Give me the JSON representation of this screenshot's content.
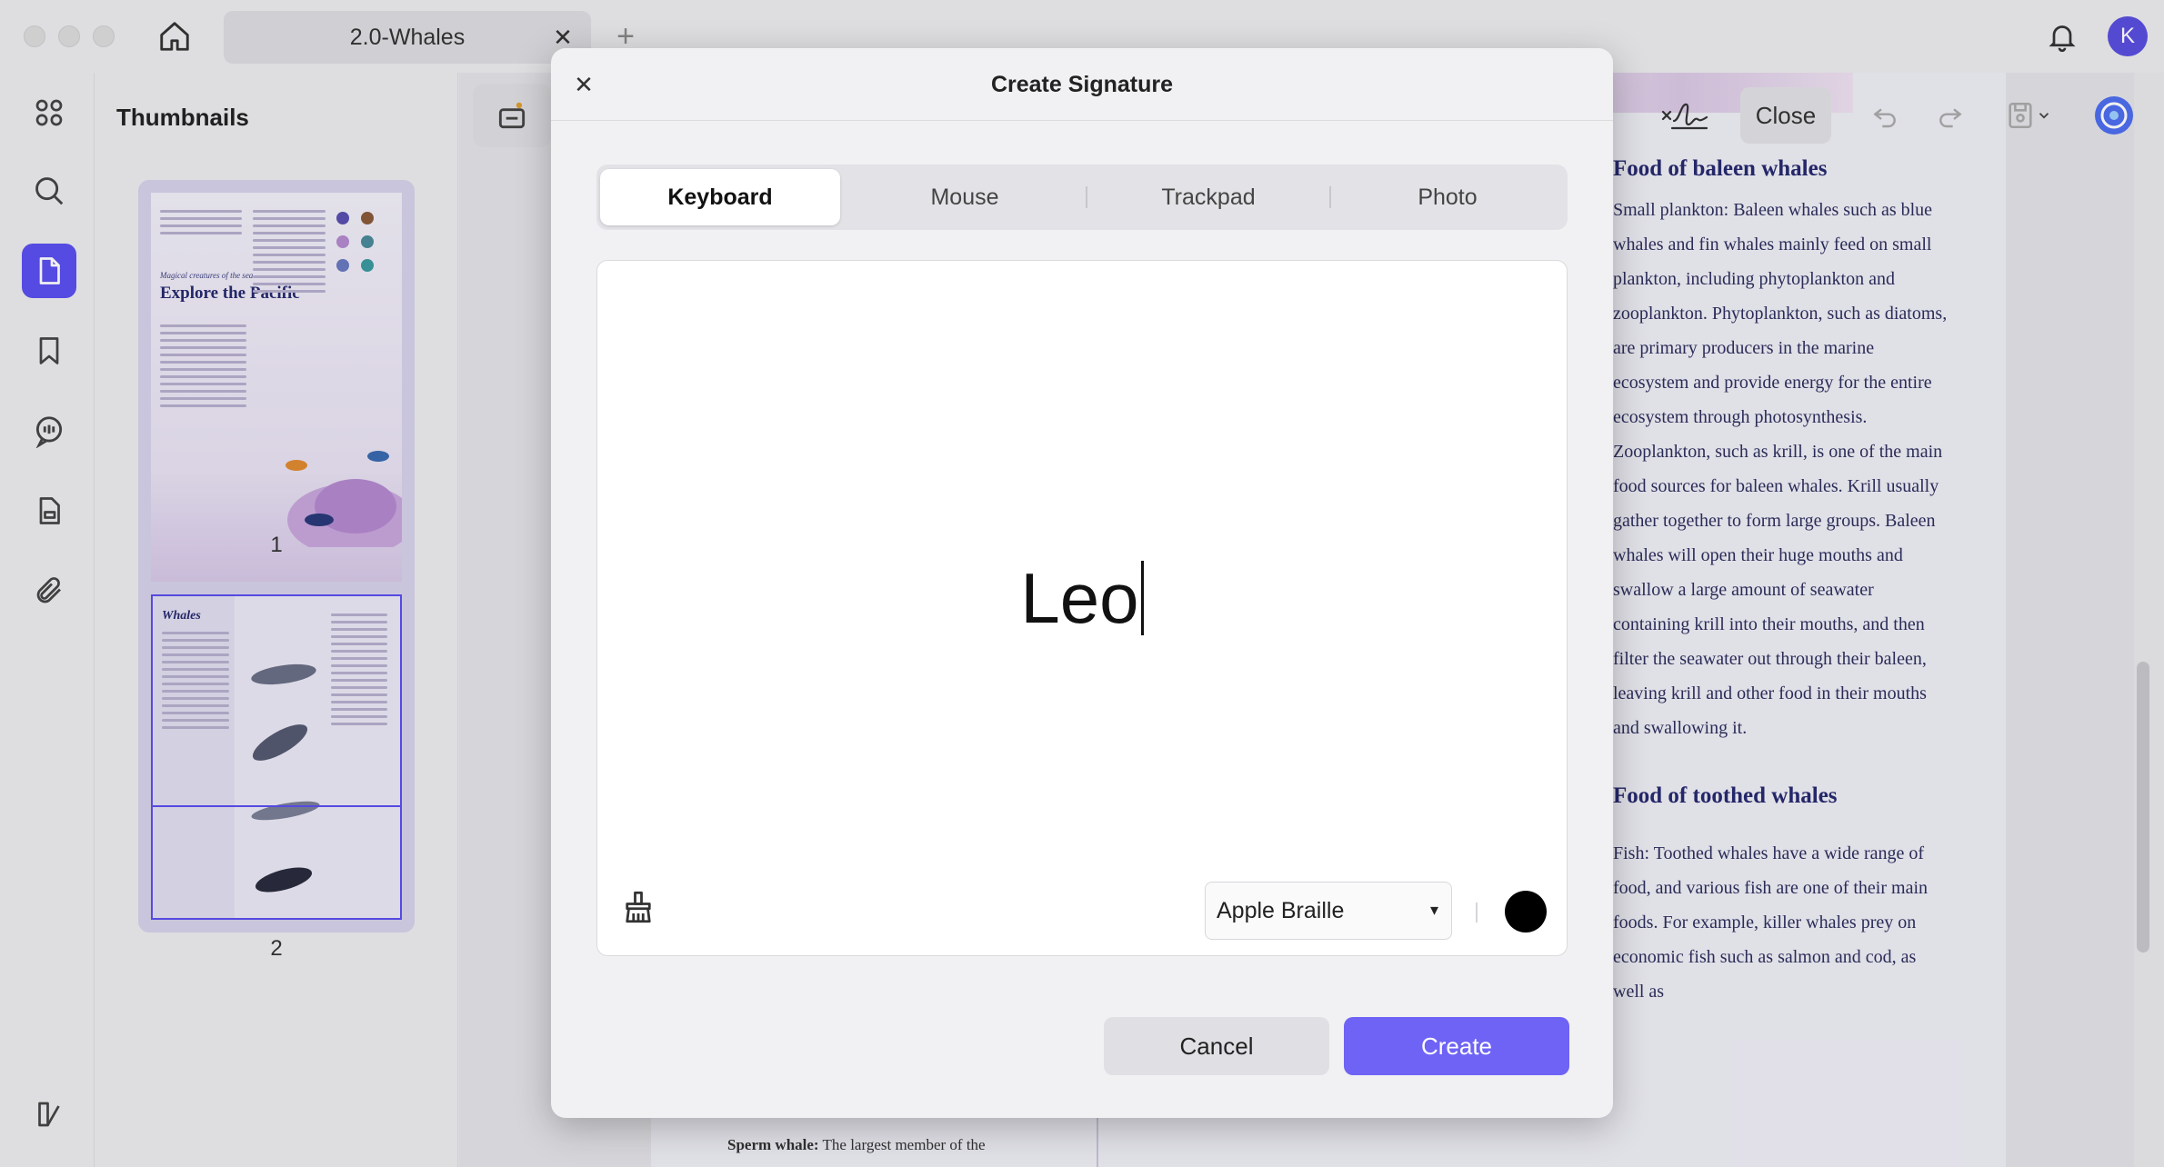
{
  "window": {
    "tab_title": "2.0-Whales",
    "tab_close": "✕",
    "tab_add": "+",
    "avatar_letter": "K",
    "accent": "#5b4ff0"
  },
  "sidebar": {
    "title": "Thumbnails",
    "pages": [
      {
        "number": "1",
        "heading_small": "Magical creatures of the sea",
        "heading": "Explore the Pacific"
      },
      {
        "number": "2",
        "heading": "Whales"
      }
    ]
  },
  "toolbar": {
    "close_label": "Close"
  },
  "document": {
    "section1_title": "Food of baleen whales",
    "section1_body": "Small plankton: Baleen whales such as blue whales and fin whales mainly feed on small plankton, including phytoplankton and zooplankton. Phytoplankton, such as diatoms, are primary producers in the marine ecosystem and provide energy for the entire ecosystem through photosynthesis. Zooplankton, such as krill, is one of the main food sources for baleen whales. Krill usually gather together to form large groups. Baleen whales will open their huge mouths and swallow a large amount of seawater containing krill into their mouths, and then filter the seawater out through their baleen, leaving krill and other food in their mouths and swallowing it.",
    "section2_title": "Food of toothed whales",
    "section2_body": "Fish: Toothed whales have a wide range of food, and various fish are one of their main foods. For example, killer whales prey on economic fish such as salmon and cod, as well as",
    "bottom_bold": "Sperm whale:",
    "bottom_text": " The largest member of the"
  },
  "modal": {
    "title": "Create Signature",
    "close": "✕",
    "tabs": [
      {
        "label": "Keyboard",
        "active": true
      },
      {
        "label": "Mouse",
        "active": false
      },
      {
        "label": "Trackpad",
        "active": false
      },
      {
        "label": "Photo",
        "active": false
      }
    ],
    "signature_text": "Leo",
    "font_value": "Apple Braille",
    "font_arrow": "▾",
    "ink_color": "#000000",
    "cancel_label": "Cancel",
    "create_label": "Create",
    "create_color": "#6e63f5"
  }
}
